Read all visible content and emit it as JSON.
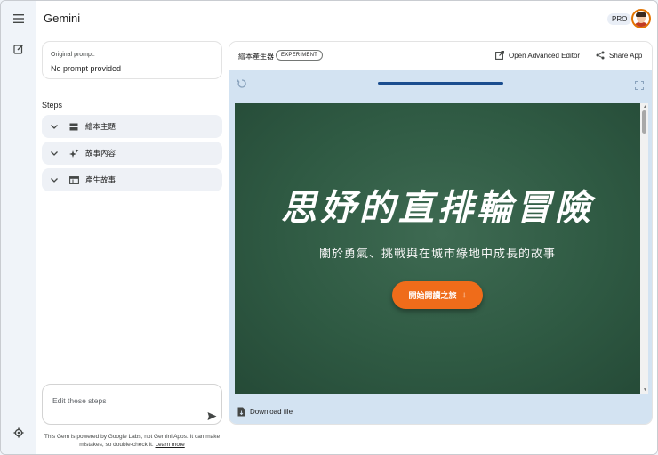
{
  "app": {
    "title": "Gemini",
    "badge": "PRO"
  },
  "prompt": {
    "label": "Original prompt:",
    "value": "No prompt provided"
  },
  "steps": {
    "title": "Steps",
    "items": [
      {
        "label": "繪本主題",
        "icon": "layout-icon"
      },
      {
        "label": "故事內容",
        "icon": "sparkle-icon"
      },
      {
        "label": "產生故事",
        "icon": "web-window-icon"
      }
    ]
  },
  "editor": {
    "placeholder": "Edit these steps"
  },
  "footnote": {
    "text": "This Gem is powered by Google Labs, not Gemini Apps. It can make mistakes, so double-check it.",
    "link": "Learn more"
  },
  "panel": {
    "title": "繪本產生器",
    "badge": "EXPERIMENT",
    "open_editor": "Open Advanced Editor",
    "share": "Share App",
    "download": "Download file"
  },
  "preview": {
    "headline": "思妤的直排輪冒險",
    "subtitle": "關於勇氣、挑戰與在城市綠地中成長的故事",
    "cta": "開始閱讀之旅",
    "cta_arrow": "↓"
  },
  "colors": {
    "accent": "#ef6c1a",
    "board": "#2f5a43",
    "panel_bg": "#d3e3f2"
  }
}
